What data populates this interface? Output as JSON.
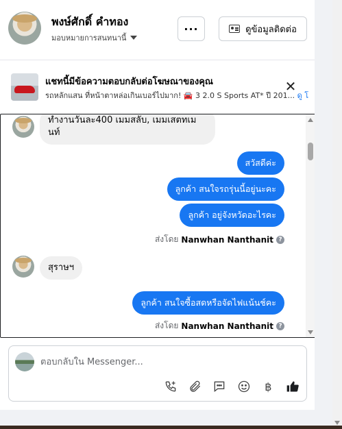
{
  "header": {
    "name": "พงษ์ศักดิ์ คำทอง",
    "assigned": "มอบหมายการสนทนานี้",
    "more_label": "···",
    "contact_label": "ดูข้อมูลติดต่อ"
  },
  "ad": {
    "title": "แชทนี้มีข้อความตอบกลับต่อโฆษณาของคุณ",
    "subtitle": "รถหลักแสน ที่หน้าตาหล่อเกินเบอร์ไปมาก! 🚘 3 2.0 S Sports AT* ปี 201...",
    "link": "ดู โ",
    "close": "✕"
  },
  "messages": {
    "in1": "ทำงานวันละ400 เมมสลับ, เมมเสตทเม นท์",
    "out1": "สวัสดีค่ะ",
    "out2": "ลูกค้า  สนใจรถรุ่นนี้อยู่นะคะ",
    "out3": "ลูกค้า   อยู่จังหวัดอะไรคะ",
    "sent_prefix": "ส่งโดย",
    "sent_name": "Nanwhan Nanthanit",
    "in2": "สุราษฯ",
    "out4": "ลูกค้า สนใจซื้อสดหรือจัดไฟแน้นช์คะ",
    "info": "?"
  },
  "composer": {
    "placeholder": "ตอบกลับใน Messenger..."
  },
  "icons": {
    "call": "call-add-icon",
    "attach": "paperclip-icon",
    "saved": "saved-reply-icon",
    "emoji": "emoji-icon",
    "baht": "฿",
    "like": "thumbs-up-icon"
  },
  "colors": {
    "accent": "#1877f2",
    "incoming": "#f0f0f0"
  }
}
